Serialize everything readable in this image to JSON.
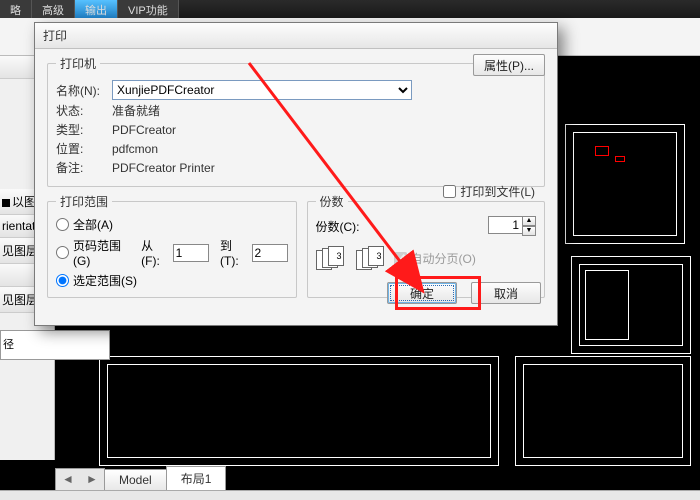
{
  "ribbon": {
    "tabs": [
      "略",
      "高级",
      "输出",
      "VIP功能"
    ]
  },
  "left_dock": {
    "items": [
      "",
      "以图",
      "rientat",
      "见图层",
      "",
      "见图层"
    ]
  },
  "left_info": "径",
  "bottom": {
    "tabs": [
      "Model",
      "布局1"
    ],
    "active": 1,
    "handles": [
      "◄",
      "►"
    ]
  },
  "dialog": {
    "title": "打印",
    "printer_group": "打印机",
    "name_label": "名称(N):",
    "printer_options": [
      "XunjiePDFCreator"
    ],
    "printer_selected": "XunjiePDFCreator",
    "properties_btn": "属性(P)...",
    "status_label": "状态:",
    "status_val": "准备就绪",
    "type_label": "类型:",
    "type_val": "PDFCreator",
    "where_label": "位置:",
    "where_val": "pdfcmon",
    "comment_label": "备注:",
    "comment_val": "PDFCreator Printer",
    "print_to_file": "打印到文件(L)",
    "range_group": "打印范围",
    "range_all": "全部(A)",
    "range_pages": "页码范围(G)",
    "from_label": "从(F):",
    "from_val": "1",
    "to_label": "到(T):",
    "to_val": "2",
    "range_selection": "选定范围(S)",
    "copies_group": "份数",
    "copies_label": "份数(C):",
    "copies_val": "1",
    "collate_label": "自动分页(O)",
    "ok": "确定",
    "cancel": "取消"
  }
}
